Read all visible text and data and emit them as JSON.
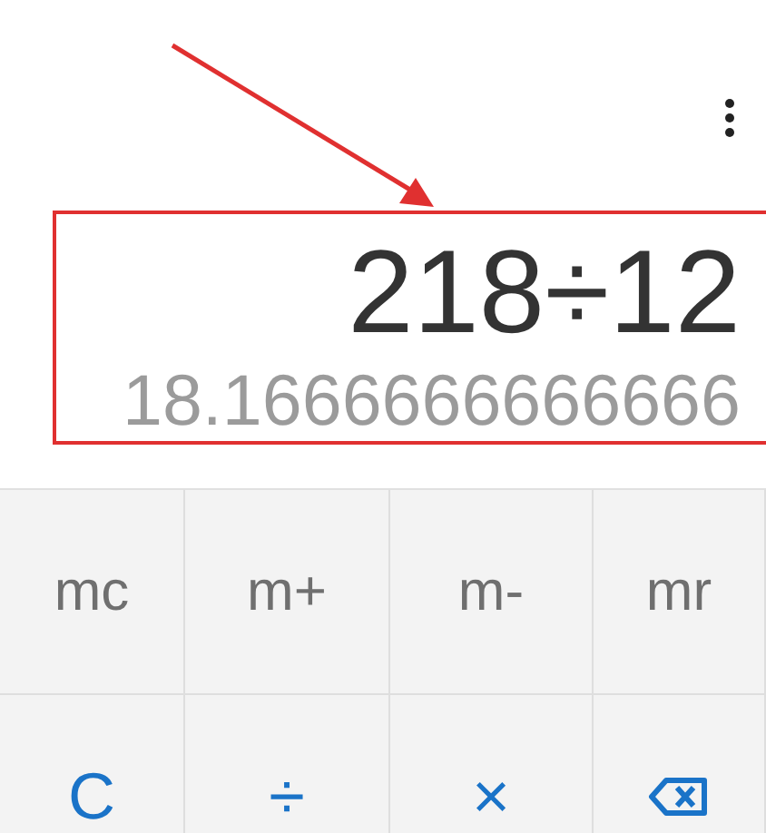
{
  "annotation": {
    "kind": "arrow-and-frame"
  },
  "display": {
    "expression": "218÷12",
    "result": "18.1666666666666"
  },
  "keys": [
    {
      "label": "mc",
      "kind": "memory"
    },
    {
      "label": "m+",
      "kind": "memory"
    },
    {
      "label": "m-",
      "kind": "memory"
    },
    {
      "label": "mr",
      "kind": "memory"
    },
    {
      "label": "C",
      "kind": "operator"
    },
    {
      "label": "÷",
      "kind": "operator"
    },
    {
      "label": "×",
      "kind": "operator"
    },
    {
      "kind": "backspace"
    }
  ]
}
